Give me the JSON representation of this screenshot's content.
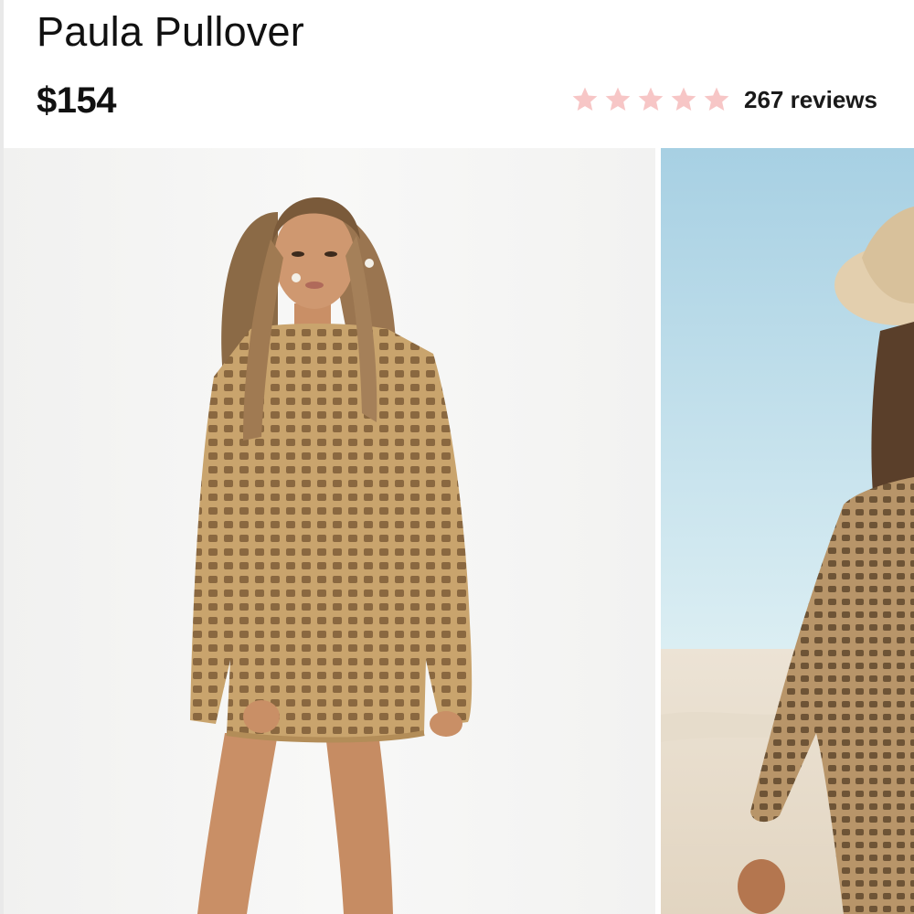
{
  "product": {
    "title": "Paula Pullover",
    "price": "$154",
    "rating": {
      "stars": 5,
      "max_stars": 5,
      "star_color": "#f7c6c6",
      "reviews_label": "267 reviews"
    }
  },
  "gallery": {
    "images": [
      {
        "name": "studio-model-photo"
      },
      {
        "name": "beach-model-photo"
      }
    ]
  }
}
